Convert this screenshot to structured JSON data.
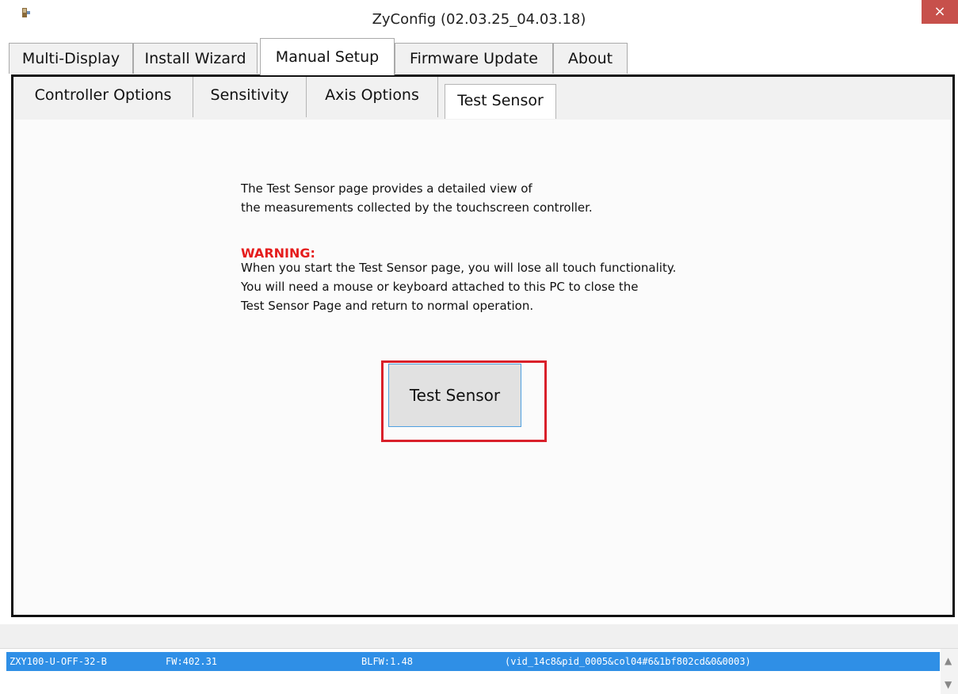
{
  "window": {
    "title": "ZyConfig (02.03.25_04.03.18)",
    "close_label": "×"
  },
  "main_tabs": [
    {
      "label": "Multi-Display"
    },
    {
      "label": "Install Wizard"
    },
    {
      "label": "Manual Setup",
      "active": true
    },
    {
      "label": "Firmware Update"
    },
    {
      "label": "About"
    }
  ],
  "sub_tabs": [
    {
      "label": "Controller Options"
    },
    {
      "label": "Sensitivity"
    },
    {
      "label": "Axis Options"
    },
    {
      "label": "Test Sensor",
      "active": true
    }
  ],
  "content": {
    "description_line1": "The Test Sensor page provides a detailed view of",
    "description_line2": "the measurements collected by the touchscreen controller.",
    "warning_label": "WARNING:",
    "warning_line1": "When you start the Test Sensor page, you will lose all touch functionality.",
    "warning_line2": "You will need a mouse or keyboard attached to this PC to close the",
    "warning_line3": "Test Sensor Page and return to normal operation.",
    "button_label": "Test Sensor"
  },
  "device_list": {
    "selected": {
      "model": "ZXY100-U-OFF-32-B",
      "fw": "FW:402.31",
      "blfw": "BLFW:1.48",
      "path": "(vid_14c8&pid_0005&col04#6&1bf802cd&0&0003)"
    }
  },
  "colors": {
    "accent": "#2f8fe6",
    "warning": "#e51c1c",
    "highlight": "#d9202a",
    "close": "#c7504b"
  },
  "icons": {
    "app": "app-icon",
    "close": "close-icon",
    "scroll_up": "chevron-up-icon",
    "scroll_down": "chevron-down-icon"
  }
}
